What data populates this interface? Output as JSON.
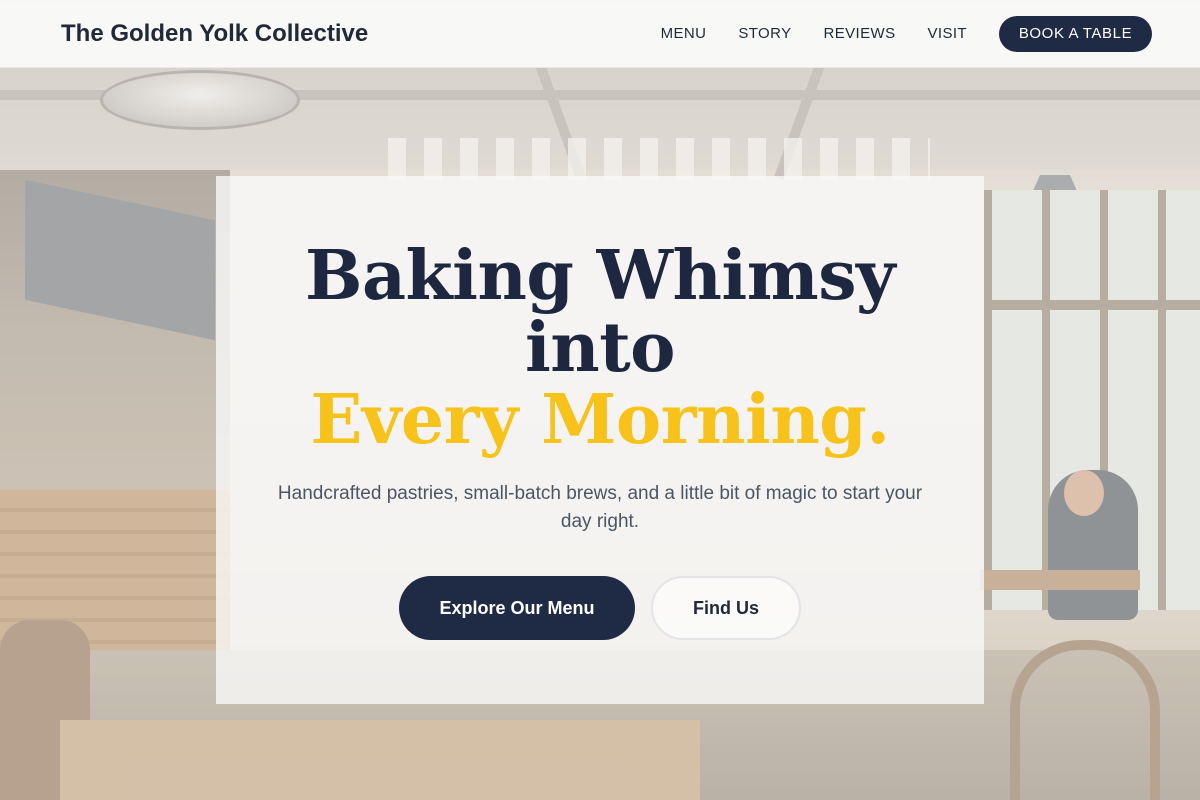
{
  "header": {
    "brand": "The Golden Yolk Collective",
    "nav": [
      "MENU",
      "STORY",
      "REVIEWS",
      "VISIT"
    ],
    "cta_label": "BOOK A TABLE"
  },
  "hero": {
    "title_line1": "Baking Whimsy",
    "title_line2": "into",
    "title_line3": "Every Morning.",
    "subtitle": "Handcrafted pastries, small-batch brews, and a little bit of magic to start your day right.",
    "primary_button": "Explore Our Menu",
    "secondary_button": "Find Us"
  },
  "colors": {
    "navy": "#1f2a44",
    "accent_gold": "#f7c21a",
    "text_muted": "#4b5563"
  }
}
